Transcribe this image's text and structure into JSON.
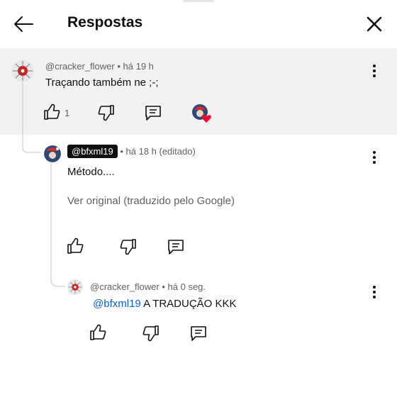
{
  "header": {
    "title": "Respostas",
    "back_icon": "arrow-left-icon",
    "close_icon": "close-icon"
  },
  "parent_comment": {
    "author": "@cracker_flower",
    "time": "há 19 h",
    "text": "Traçando também ne ;-;",
    "like_count": "1"
  },
  "reply1": {
    "author_badge": "@bfxml19",
    "time": "há 18 h (editado)",
    "text": "Método....",
    "translation_link": "Ver original (traduzido pelo Google)"
  },
  "reply2": {
    "author": "@cracker_flower",
    "time": "há 0 seg.",
    "mention": "@bfxml19",
    "text": "A TRADUÇÃO KKK"
  },
  "colors": {
    "mention": "#065fd4",
    "heart": "#ff0033",
    "highlight_bg": "#f2f2f2"
  }
}
